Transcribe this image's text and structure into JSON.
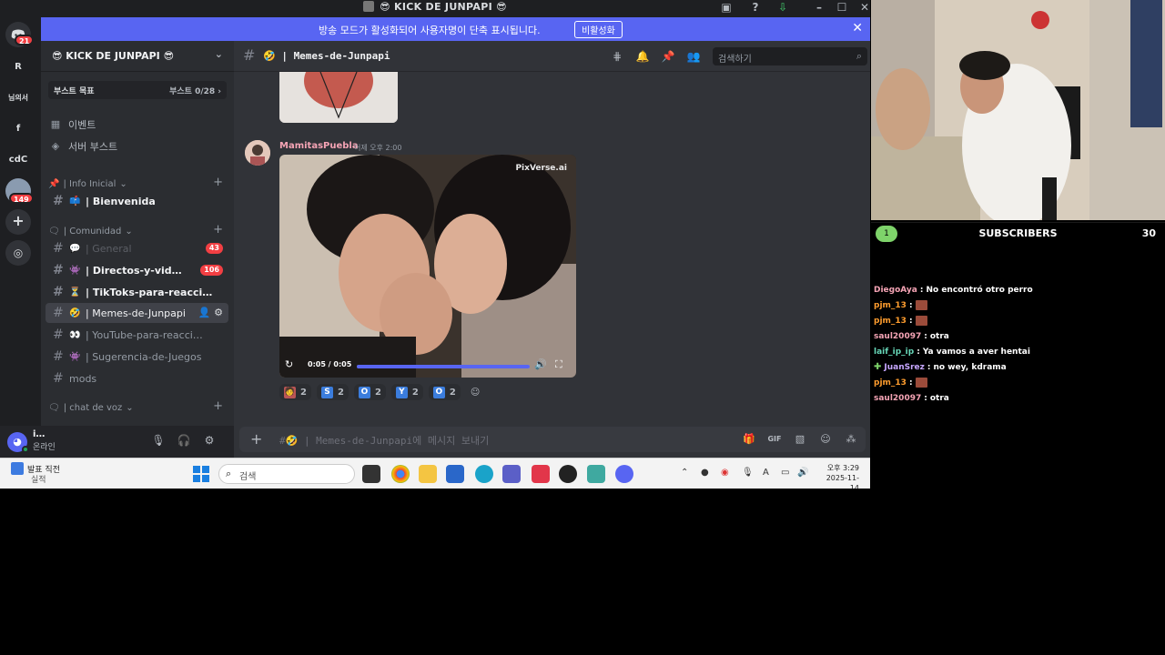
{
  "titlebar": {
    "title": "😎 KICK DE JUNPAPI 😎"
  },
  "notice": {
    "text": "방송 모드가 활성화되어 사용자명이 단축 표시됩니다.",
    "button": "비활성화"
  },
  "rail": {
    "servers": [
      {
        "label": "R"
      },
      {
        "label": "님의서"
      },
      {
        "label": "f"
      },
      {
        "label": "cdC"
      }
    ],
    "badges": {
      "home": "21",
      "avatar": "149"
    }
  },
  "guild": {
    "name": "😎 KICK DE JUNPAPI 😎",
    "boost_label": "부스트 목표",
    "boost_progress": "부스트 0/28 ›"
  },
  "nav": {
    "events": "이벤트",
    "server_boost": "서버 부스트"
  },
  "categories": {
    "info": "| Info Inicial",
    "comunidad": "| Comunidad",
    "voice": "| chat de voz"
  },
  "channels": [
    {
      "name": "| Bienvenida",
      "emoji": "📫"
    },
    {
      "name": "| General",
      "emoji": "💬",
      "badge": "43"
    },
    {
      "name": "| Directos-y-vid…",
      "emoji": "👾",
      "badge": "106"
    },
    {
      "name": "| TikToks-para-reacci…",
      "emoji": "⏳"
    },
    {
      "name": "| Memes-de-Junpapi",
      "emoji": "🤣"
    },
    {
      "name": "| YouTube-para-reacci…",
      "emoji": "👀"
    },
    {
      "name": "| Sugerencia-de-Juegos",
      "emoji": "👾"
    },
    {
      "name": "mods",
      "emoji": ""
    }
  ],
  "user": {
    "name": "i…",
    "status": "온라인"
  },
  "channel_header": {
    "name": "🤣 | Memes-de-Junpapi",
    "search_placeholder": "검색하기"
  },
  "message": {
    "author": "MamitasPuebla",
    "time": "어제 오후 2:00",
    "video_watermark": "PixVerse.ai",
    "video_time": "0:05 / 0:05",
    "video_progress": 1.0
  },
  "reactions": [
    {
      "emoji": "🧑",
      "letter": "",
      "color": "#b55",
      "count": "2"
    },
    {
      "emoji": "",
      "letter": "S",
      "color": "#3b7ddd",
      "count": "2"
    },
    {
      "emoji": "",
      "letter": "O",
      "color": "#3b7ddd",
      "count": "2"
    },
    {
      "emoji": "",
      "letter": "Y",
      "color": "#3b7ddd",
      "count": "2"
    },
    {
      "emoji": "",
      "letter": "O",
      "color": "#3b7ddd",
      "count": "2"
    }
  ],
  "composer": {
    "placeholder": "#🤣 | Memes-de-Junpapi에 메시지 보내기"
  },
  "taskbar": {
    "weather_line1": "발표 직전",
    "weather_line2": "실적",
    "search_placeholder": "검색",
    "tray_lang": "A",
    "clock_time": "오후 3:29",
    "clock_date": "2025-11-14"
  },
  "overlay": {
    "subscribers_label": "SUBSCRIBERS",
    "subscribers_count": "30",
    "level": "1",
    "chat": [
      {
        "user": "DiegoAya",
        "color": "#f5a4b5",
        "text": "No encontró otro perro",
        "emote": false,
        "gift": false
      },
      {
        "user": "pjm_13",
        "color": "#ff9d2e",
        "text": "",
        "emote": true,
        "gift": false
      },
      {
        "user": "pjm_13",
        "color": "#ff9d2e",
        "text": "",
        "emote": true,
        "gift": false
      },
      {
        "user": "saul20097",
        "color": "#f5a4b5",
        "text": "otra",
        "emote": false,
        "gift": false
      },
      {
        "user": "laif_ip_ip",
        "color": "#67d7b8",
        "text": "Ya vamos a aver hentai",
        "emote": false,
        "gift": false
      },
      {
        "user": "JuanSrez",
        "color": "#c6a6ff",
        "text": "no wey, kdrama",
        "emote": false,
        "gift": true
      },
      {
        "user": "pjm_13",
        "color": "#ff9d2e",
        "text": "",
        "emote": true,
        "gift": false
      },
      {
        "user": "saul20097",
        "color": "#f5a4b5",
        "text": "otra",
        "emote": false,
        "gift": false
      }
    ]
  }
}
